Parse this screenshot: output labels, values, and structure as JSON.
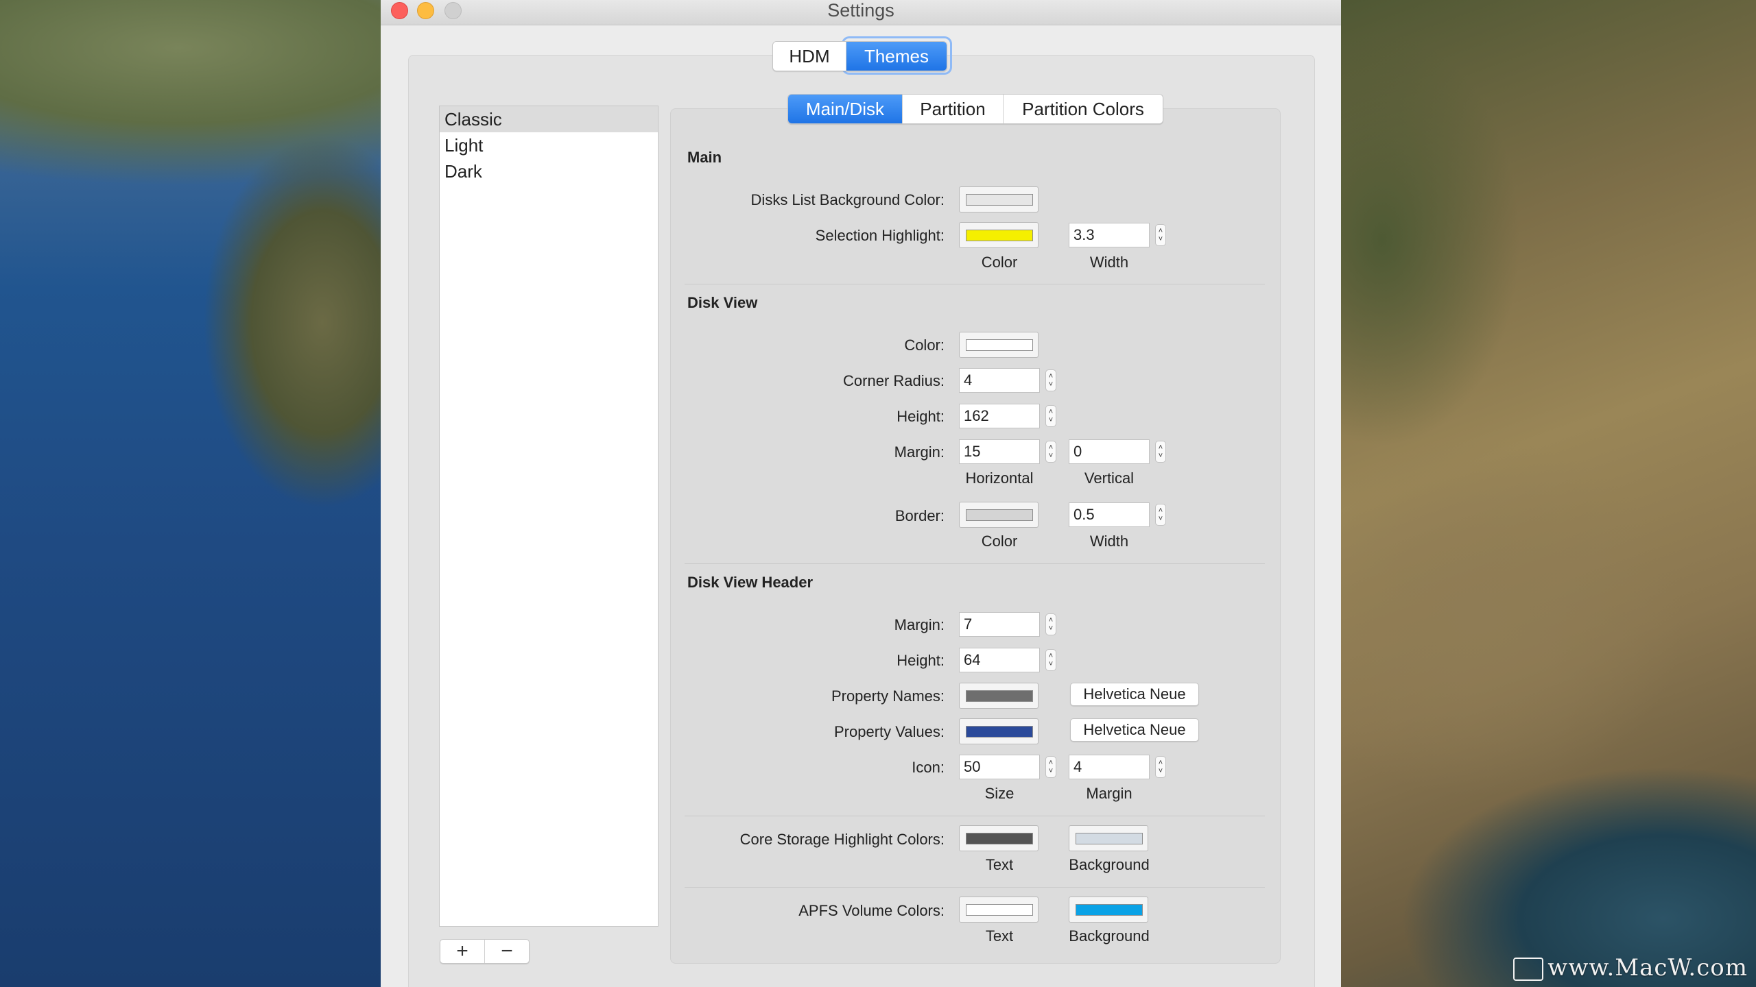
{
  "window": {
    "title": "Settings"
  },
  "top_tabs": [
    {
      "label": "HDM",
      "active": false
    },
    {
      "label": "Themes",
      "active": true
    }
  ],
  "themes": {
    "items": [
      "Classic",
      "Light",
      "Dark"
    ],
    "selected": "Classic",
    "add_label": "+",
    "remove_label": "−"
  },
  "sub_tabs": [
    {
      "label": "Main/Disk",
      "active": true
    },
    {
      "label": "Partition",
      "active": false
    },
    {
      "label": "Partition Colors",
      "active": false
    }
  ],
  "main": {
    "title": "Main",
    "disks_list_bg_label": "Disks List Background Color:",
    "disks_list_bg_color": "#e6e6e6",
    "selection_highlight_label": "Selection Highlight:",
    "selection_highlight_color": "#f5ef00",
    "selection_highlight_width": "3.3",
    "color_caption": "Color",
    "width_caption": "Width"
  },
  "disk_view": {
    "title": "Disk View",
    "color_label": "Color:",
    "color": "#ffffff",
    "corner_radius_label": "Corner Radius:",
    "corner_radius": "4",
    "height_label": "Height:",
    "height": "162",
    "margin_label": "Margin:",
    "margin_horizontal": "15",
    "margin_vertical": "0",
    "horizontal_caption": "Horizontal",
    "vertical_caption": "Vertical",
    "border_label": "Border:",
    "border_color": "#d4d4d4",
    "border_width": "0.5",
    "color_caption": "Color",
    "width_caption": "Width"
  },
  "disk_view_header": {
    "title": "Disk View Header",
    "margin_label": "Margin:",
    "margin": "7",
    "height_label": "Height:",
    "height": "64",
    "property_names_label": "Property Names:",
    "property_names_color": "#6e6e6e",
    "property_names_font": "Helvetica Neue",
    "property_values_label": "Property Values:",
    "property_values_color": "#2b4a9a",
    "property_values_font": "Helvetica Neue",
    "icon_label": "Icon:",
    "icon_size": "50",
    "icon_margin": "4",
    "size_caption": "Size",
    "margin_caption": "Margin"
  },
  "core_storage": {
    "label": "Core Storage Highlight Colors:",
    "text_color": "#555555",
    "background_color": "#d3dbe3",
    "text_caption": "Text",
    "background_caption": "Background"
  },
  "apfs": {
    "label": "APFS Volume Colors:",
    "text_color": "#ffffff",
    "background_color": "#0aa2e6",
    "text_caption": "Text",
    "background_caption": "Background"
  },
  "watermark": "www.MacW.com",
  "stepper_up": "˄",
  "stepper_down": "˅"
}
